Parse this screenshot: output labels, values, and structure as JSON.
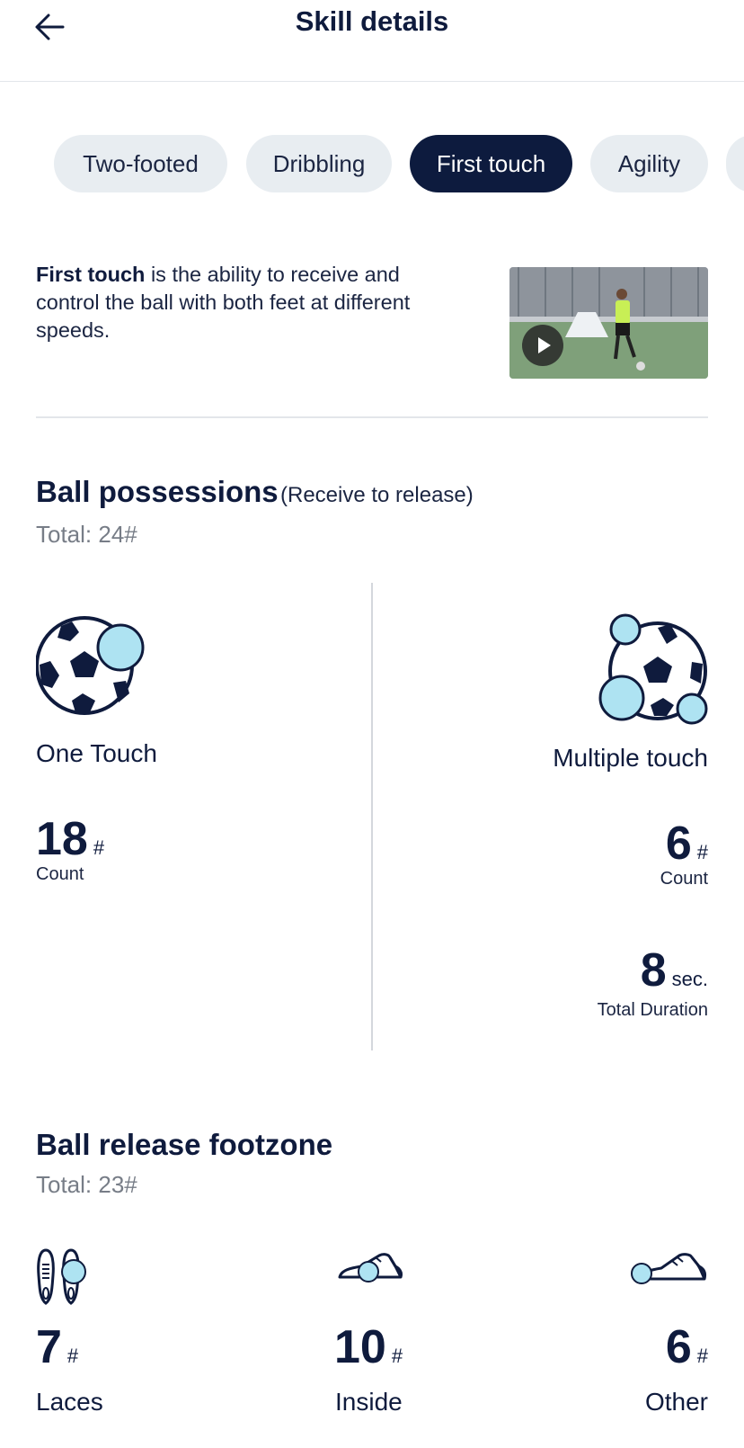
{
  "header": {
    "title": "Skill details"
  },
  "chips": [
    {
      "label": "Two-footed",
      "active": false
    },
    {
      "label": "Dribbling",
      "active": false
    },
    {
      "label": "First touch",
      "active": true
    },
    {
      "label": "Agility",
      "active": false
    }
  ],
  "description": {
    "term": "First touch",
    "text": " is the ability to receive and control the ball with both feet at different speeds."
  },
  "possessions": {
    "title": "Ball possessions",
    "subtitle": "(Receive to release)",
    "total": "Total: 24#",
    "one_touch": {
      "label": "One Touch",
      "count": "18",
      "count_unit": "#",
      "count_label": "Count"
    },
    "multiple_touch": {
      "label": "Multiple touch",
      "count": "6",
      "count_unit": "#",
      "count_label": "Count",
      "duration": "8",
      "duration_unit": "sec.",
      "duration_label": "Total Duration"
    }
  },
  "footzone": {
    "title": "Ball release footzone",
    "total": "Total: 23#",
    "items": [
      {
        "value": "7",
        "unit": "#",
        "label": "Laces"
      },
      {
        "value": "10",
        "unit": "#",
        "label": "Inside"
      },
      {
        "value": "6",
        "unit": "#",
        "label": "Other"
      }
    ]
  },
  "colors": {
    "navy": "#0d1b3e",
    "chip_bg": "#e8edf1",
    "highlight": "#aee3f2"
  }
}
